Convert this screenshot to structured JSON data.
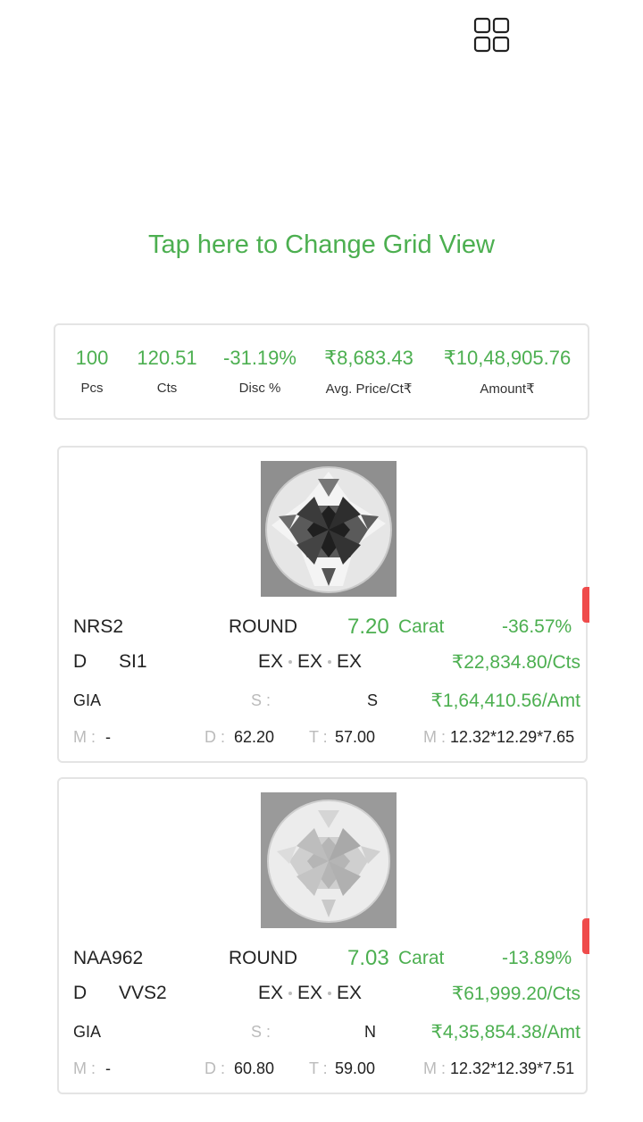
{
  "header": {
    "grid_icon": "grid-icon"
  },
  "hint": "Tap here to Change Grid View",
  "summary": {
    "pcs": {
      "value": "100",
      "label": "Pcs"
    },
    "cts": {
      "value": "120.51",
      "label": "Cts"
    },
    "disc": {
      "value": "-31.19%",
      "label": "Disc %"
    },
    "avg": {
      "value": "₹8,683.43",
      "label": "Avg. Price/Ct₹"
    },
    "amount": {
      "value": "₹10,48,905.76",
      "label": "Amount₹"
    }
  },
  "cards": [
    {
      "stone_id": "NRS2",
      "shape": "ROUND",
      "carat": "7.20",
      "carat_unit": "Carat",
      "discount": "-36.57%",
      "color": "D",
      "clarity": "SI1",
      "cut": "EX",
      "polish": "EX",
      "symmetry": "EX",
      "price_per_ct": "₹22,834.80/Cts",
      "lab": "GIA",
      "s_label": "S :",
      "s_value": "S",
      "amount": "₹1,64,410.56/Amt",
      "m_label": "M :",
      "m_value": "-",
      "d_label": "D :",
      "d_value": "62.20",
      "t_label": "T :",
      "t_value": "57.00",
      "meas_label": "M :",
      "meas_value": "12.32*12.29*7.65"
    },
    {
      "stone_id": "NAA962",
      "shape": "ROUND",
      "carat": "7.03",
      "carat_unit": "Carat",
      "discount": "-13.89%",
      "color": "D",
      "clarity": "VVS2",
      "cut": "EX",
      "polish": "EX",
      "symmetry": "EX",
      "price_per_ct": "₹61,999.20/Cts",
      "lab": "GIA",
      "s_label": "S :",
      "s_value": "N",
      "amount": "₹4,35,854.38/Amt",
      "m_label": "M :",
      "m_value": "-",
      "d_label": "D :",
      "d_value": "60.80",
      "t_label": "T :",
      "t_value": "59.00",
      "meas_label": "M :",
      "meas_value": "12.32*12.39*7.51"
    }
  ]
}
